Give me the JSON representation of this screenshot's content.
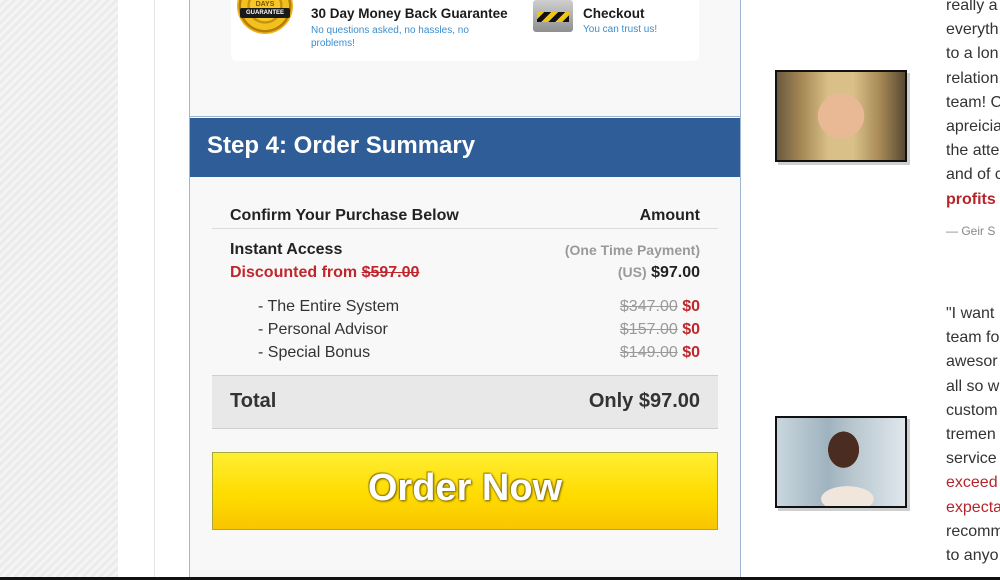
{
  "guarantee": {
    "seal_days": "DAYS",
    "seal_label": "GUARANTEE",
    "title": "30 Day Money Back Guarantee",
    "subtitle": "No questions asked, no hassles, no problems!"
  },
  "checkout": {
    "title": "Checkout",
    "subtitle": "You can trust us!"
  },
  "step": {
    "title": "Step 4: Order Summary"
  },
  "summary": {
    "header_left": "Confirm Your Purchase Below",
    "header_right": "Amount",
    "instant_access": "Instant Access",
    "discount_prefix": "Discounted from ",
    "discount_old": "$597.00",
    "payment_note": "(One Time Payment)",
    "currency": "(US)",
    "price": "$97.00",
    "items": [
      {
        "label": "- The Entire System",
        "old": "$347.00",
        "new": "$0"
      },
      {
        "label": "- Personal Advisor",
        "old": "$157.00",
        "new": "$0"
      },
      {
        "label": "- Special Bonus",
        "old": "$149.00",
        "new": "$0"
      }
    ],
    "total_label": "Total",
    "total_value": "Only $97.00"
  },
  "order_button": {
    "label": "Order Now"
  },
  "testimonials": [
    {
      "lines": [
        "really a",
        "everyth",
        "to a lon",
        "relation",
        "team! C",
        "apreicia",
        "the atte",
        "and of c"
      ],
      "highlight": "profits",
      "author": "— Geir S"
    },
    {
      "lines": [
        "\"I want",
        "team fo",
        "awesor",
        "all so w",
        "custom",
        "tremen",
        "service"
      ],
      "highlight_lines": [
        "exceed",
        "expecta"
      ],
      "tail_lines": [
        "recomm",
        "to anyo"
      ]
    }
  ]
}
